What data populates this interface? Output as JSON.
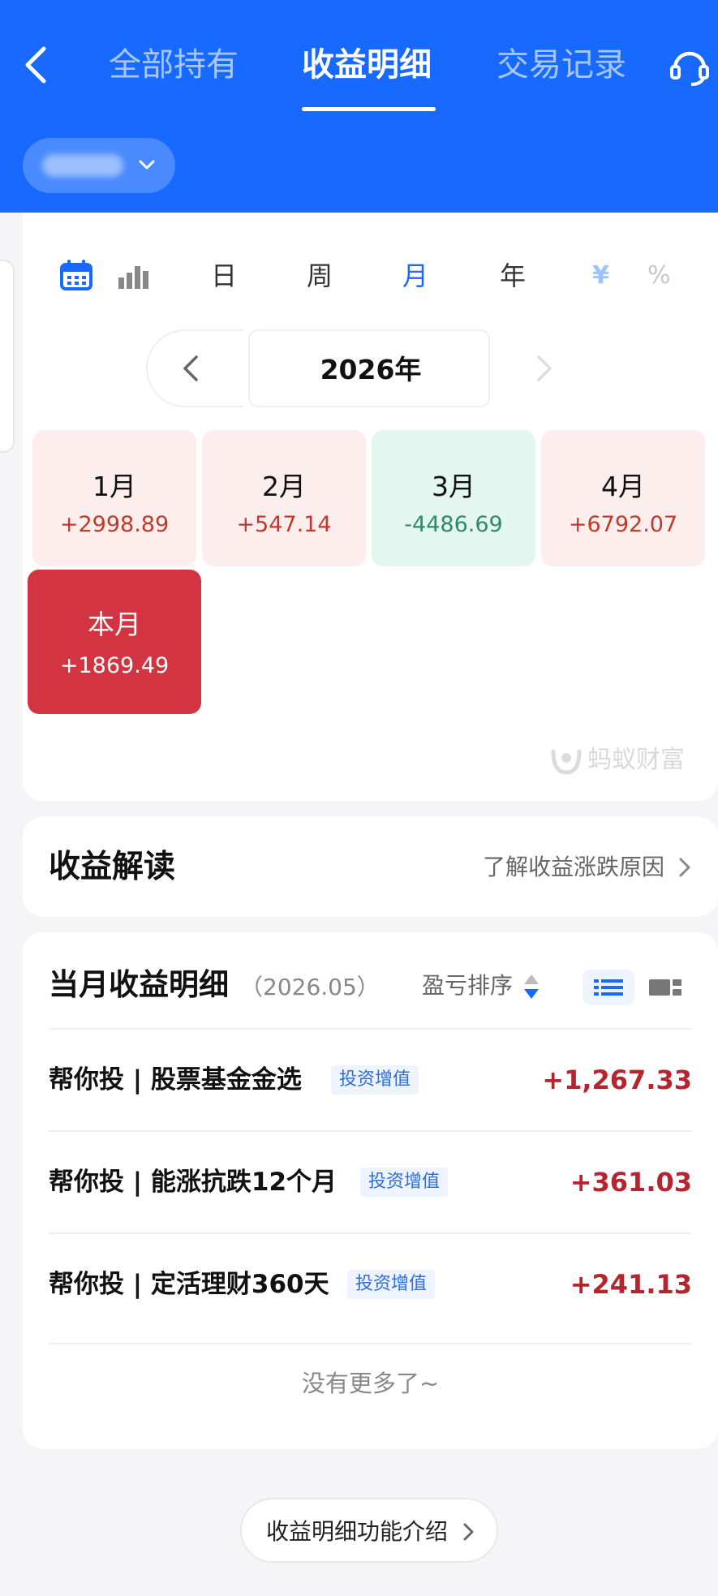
{
  "header": {
    "tabs": [
      {
        "label": "全部持有"
      },
      {
        "label": "收益明细"
      },
      {
        "label": "交易记录"
      }
    ],
    "active_tab": "收益明细",
    "icons": {
      "back": "chevron-left-icon",
      "service": "customer-service-icon",
      "account_dropdown": "chevron-down-icon"
    },
    "account_name_blurred": true
  },
  "calendar": {
    "view_icons": [
      "calendar-icon",
      "bar-chart-icon"
    ],
    "granularity": [
      "日",
      "周",
      "月",
      "年"
    ],
    "selected_granularity": "月",
    "units": {
      "amount": "¥",
      "percent": "%"
    },
    "year_label": "2026年",
    "months": [
      {
        "name": "1月",
        "value": "+2998.89",
        "trend": "up"
      },
      {
        "name": "2月",
        "value": "+547.14",
        "trend": "up"
      },
      {
        "name": "3月",
        "value": "-4486.69",
        "trend": "down"
      },
      {
        "name": "4月",
        "value": "+6792.07",
        "trend": "up"
      },
      {
        "name": "本月",
        "value": "+1869.49",
        "trend": "current"
      }
    ],
    "watermark": "蚂蚁财富"
  },
  "interpretation": {
    "title": "收益解读",
    "link": "了解收益涨跌原因"
  },
  "detail": {
    "title": "当月收益明细",
    "period": "（2026.05）",
    "sort_label": "盈亏排序",
    "rows": [
      {
        "name": "帮你投 | 股票基金金选",
        "tag": "投资增值",
        "value": "+1,267.33"
      },
      {
        "name": "帮你投 | 能涨抗跌12个月",
        "tag": "投资增值",
        "value": "+361.03"
      },
      {
        "name": "帮你投 | 定活理财360天",
        "tag": "投资增值",
        "value": "+241.13"
      }
    ],
    "end_text": "没有更多了~"
  },
  "footer": {
    "intro_button": "收益明细功能介绍"
  },
  "colors": {
    "brand_blue": "#1769ff",
    "gain_red": "#c0392b",
    "loss_green": "#2e8a6a",
    "current_month_bg": "#d23541"
  }
}
